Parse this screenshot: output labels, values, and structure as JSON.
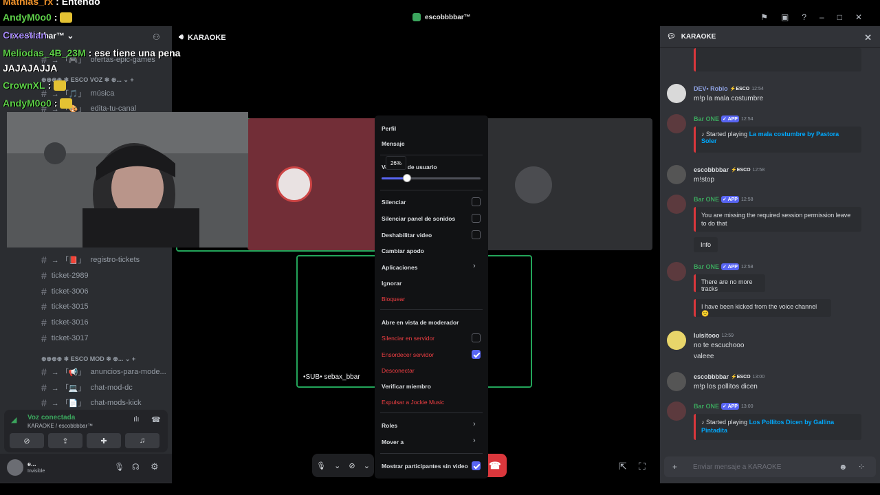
{
  "window": {
    "title": "escobbbbar™"
  },
  "overlay_chat": [
    {
      "user": "Mathias_rx",
      "text": ": Entendo",
      "color": "#f0932b"
    },
    {
      "user": "AndyM0o0",
      "text": ":",
      "color": "#5fd24a"
    },
    {
      "user": "Crxestian",
      "text": "",
      "color": "#a78bfa"
    },
    {
      "user": "Meliodas_4B_23M",
      "text": ": ese tiene una pena",
      "color": "#5fd24a"
    },
    {
      "user": "",
      "text": "JAJAJAJJA",
      "color": "#ffffff"
    },
    {
      "user": "CrownXL",
      "text": ":",
      "color": "#5fd24a"
    },
    {
      "user": "AndyM0o0",
      "text": ":",
      "color": "#5fd24a"
    }
  ],
  "sidebar": {
    "server": "escobbbbar™",
    "top_channels": [
      {
        "name": "ofertas-epic-games",
        "prefix": "→ 「🎮」"
      },
      {
        "name": "música",
        "prefix": "→ 「🎵」"
      },
      {
        "name": "edita-tu-canal",
        "prefix": "→ 「🎨」"
      }
    ],
    "category_voz": "ESCO VOZ",
    "channels": [
      {
        "name": "registro-tickets",
        "prefix": "→ 「📕」"
      },
      {
        "name": "ticket-2989",
        "prefix": ""
      },
      {
        "name": "ticket-3006",
        "prefix": ""
      },
      {
        "name": "ticket-3015",
        "prefix": ""
      },
      {
        "name": "ticket-3016",
        "prefix": ""
      },
      {
        "name": "ticket-3017",
        "prefix": ""
      }
    ],
    "category_mod": "ESCO MOD",
    "mod_channels": [
      {
        "name": "anuncios-para-mode...",
        "prefix": "→ 「📢」"
      },
      {
        "name": "chat-mod-dc",
        "prefix": "→ 「💻」"
      },
      {
        "name": "chat-mods-kick",
        "prefix": "→ 「📄」"
      }
    ],
    "voice": {
      "status": "Voz conectada",
      "location": "KARAOKE / escobbbbar™"
    },
    "user": {
      "name": "e...",
      "status": "Invisible"
    }
  },
  "stage": {
    "channel": "KARAOKE",
    "sub_tile_label": "•SUB• sebax_bbar"
  },
  "context_menu": {
    "perfil": "Perfil",
    "mensaje": "Mensaje",
    "volumen": "Volumen de usuario",
    "volume_pct": 26,
    "volume_label": "26%",
    "silenciar": "Silenciar",
    "silenciar_panel": "Silenciar panel de sonidos",
    "deshabilitar_video": "Deshabilitar video",
    "cambiar_apodo": "Cambiar apodo",
    "aplicaciones": "Aplicaciones",
    "ignorar": "Ignorar",
    "bloquear": "Bloquear",
    "moderador": "Abre en vista de moderador",
    "silenciar_servidor": "Silenciar en servidor",
    "ensordecer": "Ensordecer servidor",
    "desconectar": "Desconectar",
    "verificar": "Verificar miembro",
    "expulsar": "Expulsar a Jockie Music",
    "roles": "Roles",
    "mover": "Mover a",
    "mostrar": "Mostrar participantes sin video"
  },
  "chat": {
    "title": "KARAOKE",
    "placeholder": "Enviar mensaje a KARAOKE",
    "messages": [
      {
        "user": "DEV• Roblo",
        "time": "12:54",
        "text": "m!p la mala costumbre",
        "color": "#8ea1e1"
      },
      {
        "user": "Bar ONE",
        "time": "12:54",
        "badge": "✓ APP",
        "embed_prefix": "Started playing ",
        "embed_link": "La mala costumbre by Pastora Soler",
        "color": "#3ba55d"
      },
      {
        "user": "escobbbbar",
        "time": "12:58",
        "text": "m!stop",
        "tag": "ESCO",
        "color": "#dbdee1"
      },
      {
        "user": "Bar ONE",
        "time": "12:58",
        "badge": "✓ APP",
        "embed_text": "You are missing the required session permission leave to do that",
        "info": "Info",
        "color": "#3ba55d"
      },
      {
        "user": "Bar ONE",
        "time": "12:58",
        "badge": "✓ APP",
        "embed_text": "There are no more tracks",
        "embed_text2": "I have been kicked from the voice channel 🙁",
        "color": "#3ba55d"
      },
      {
        "user": "luisitooo",
        "time": "12:59",
        "text": "no te escuchooo",
        "text2": "valeee",
        "color": "#dbdee1"
      },
      {
        "user": "escobbbbar",
        "time": "13:00",
        "text": "m!p los pollitos dicen",
        "tag": "ESCO",
        "color": "#dbdee1"
      },
      {
        "user": "Bar ONE",
        "time": "13:00",
        "badge": "✓ APP",
        "embed_prefix": "Started playing ",
        "embed_link": "Los Pollitos Dicen by Gallina Pintadita",
        "color": "#3ba55d"
      }
    ]
  }
}
